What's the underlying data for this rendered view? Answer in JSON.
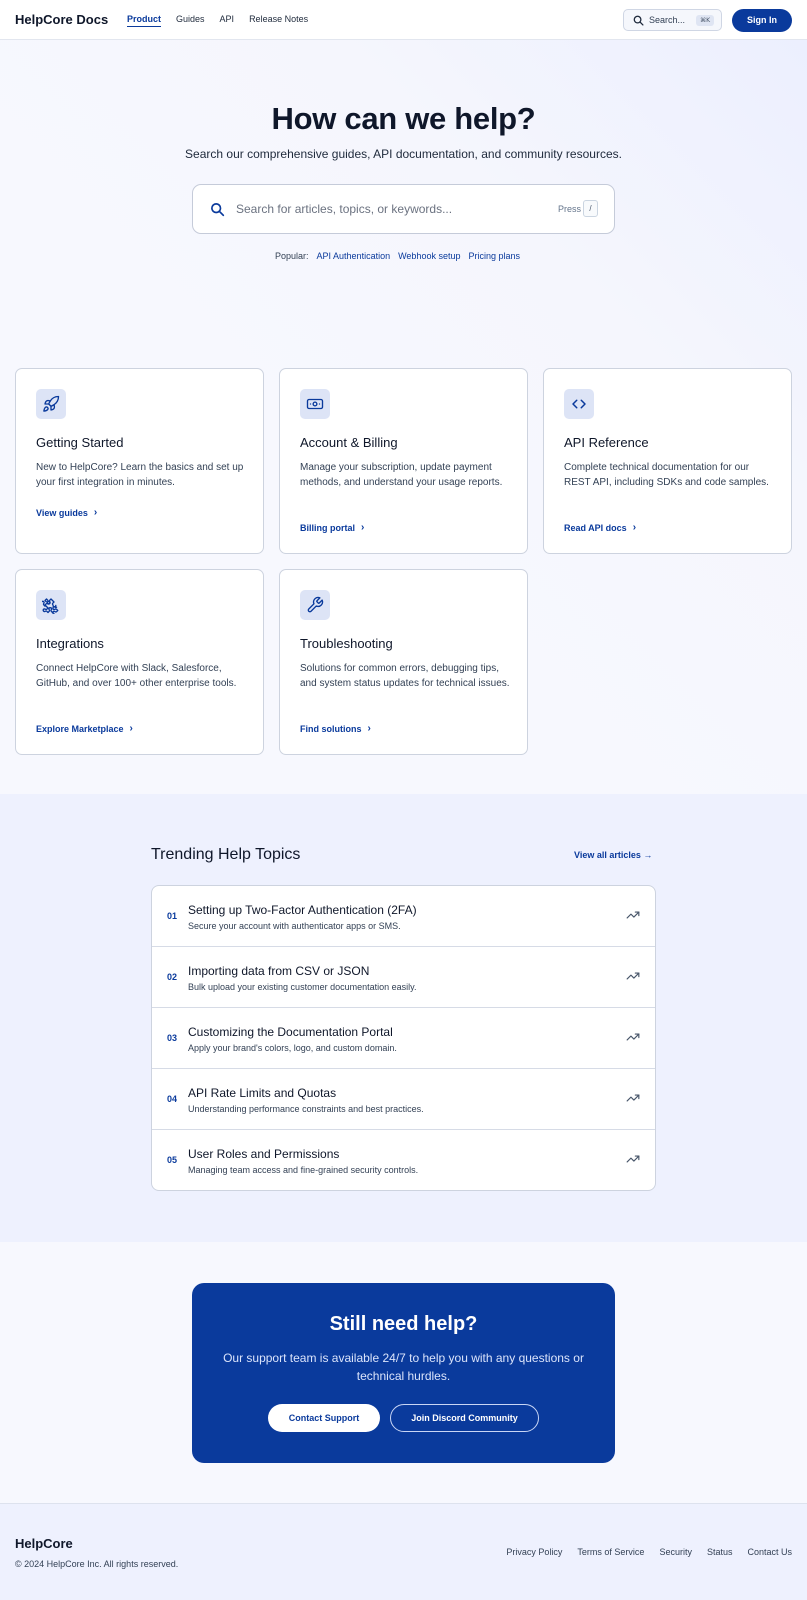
{
  "header": {
    "brand": "HelpCore Docs",
    "nav": [
      "Product",
      "Guides",
      "API",
      "Release Notes"
    ],
    "search_label": "Search...",
    "search_shortcut": "⌘K",
    "signin_label": "Sign In"
  },
  "hero": {
    "title": "How can we help?",
    "subtitle": "Search our comprehensive guides, API documentation, and community resources.",
    "search_placeholder": "Search for articles, topics, or keywords...",
    "press_label": "Press",
    "press_key": "/",
    "popular_label": "Popular:",
    "popular_links": [
      "API Authentication",
      "Webhook setup",
      "Pricing plans"
    ]
  },
  "cards": [
    {
      "icon": "rocket-icon",
      "title": "Getting Started",
      "desc": "New to HelpCore? Learn the basics and set up your first integration in minutes.",
      "link": "View guides"
    },
    {
      "icon": "billing-icon",
      "title": "Account & Billing",
      "desc": "Manage your subscription, update payment methods, and understand your usage reports.",
      "link": "Billing portal"
    },
    {
      "icon": "code-icon",
      "title": "API Reference",
      "desc": "Complete technical documentation for our REST API, including SDKs and code samples.",
      "link": "Read API docs"
    },
    {
      "icon": "puzzle-icon",
      "title": "Integrations",
      "desc": "Connect HelpCore with Slack, Salesforce, GitHub, and over 100+ other enterprise tools.",
      "link": "Explore Marketplace"
    },
    {
      "icon": "wrench-icon",
      "title": "Troubleshooting",
      "desc": "Solutions for common errors, debugging tips, and system status updates for technical issues.",
      "link": "Find solutions"
    }
  ],
  "trending": {
    "title": "Trending Help Topics",
    "view_all": "View all articles →",
    "items": [
      {
        "num": "01",
        "title": "Setting up Two-Factor Authentication (2FA)",
        "sub": "Secure your account with authenticator apps or SMS."
      },
      {
        "num": "02",
        "title": "Importing data from CSV or JSON",
        "sub": "Bulk upload your existing customer documentation easily."
      },
      {
        "num": "03",
        "title": "Customizing the Documentation Portal",
        "sub": "Apply your brand's colors, logo, and custom domain."
      },
      {
        "num": "04",
        "title": "API Rate Limits and Quotas",
        "sub": "Understanding performance constraints and best practices."
      },
      {
        "num": "05",
        "title": "User Roles and Permissions",
        "sub": "Managing team access and fine-grained security controls."
      }
    ]
  },
  "cta": {
    "title": "Still need help?",
    "subtitle": "Our support team is available 24/7 to help you with any questions or technical hurdles.",
    "primary": "Contact Support",
    "secondary": "Join Discord Community"
  },
  "footer": {
    "brand": "HelpCore",
    "copyright": "© 2024 HelpCore Inc. All rights reserved.",
    "links": [
      "Privacy Policy",
      "Terms of Service",
      "Security",
      "Status",
      "Contact Us"
    ]
  },
  "colors": {
    "accent": "#0a3a9c",
    "page_bg": "#f7f8fe",
    "section_bg": "#eef1fe",
    "icon_tile": "#dde4f6"
  }
}
